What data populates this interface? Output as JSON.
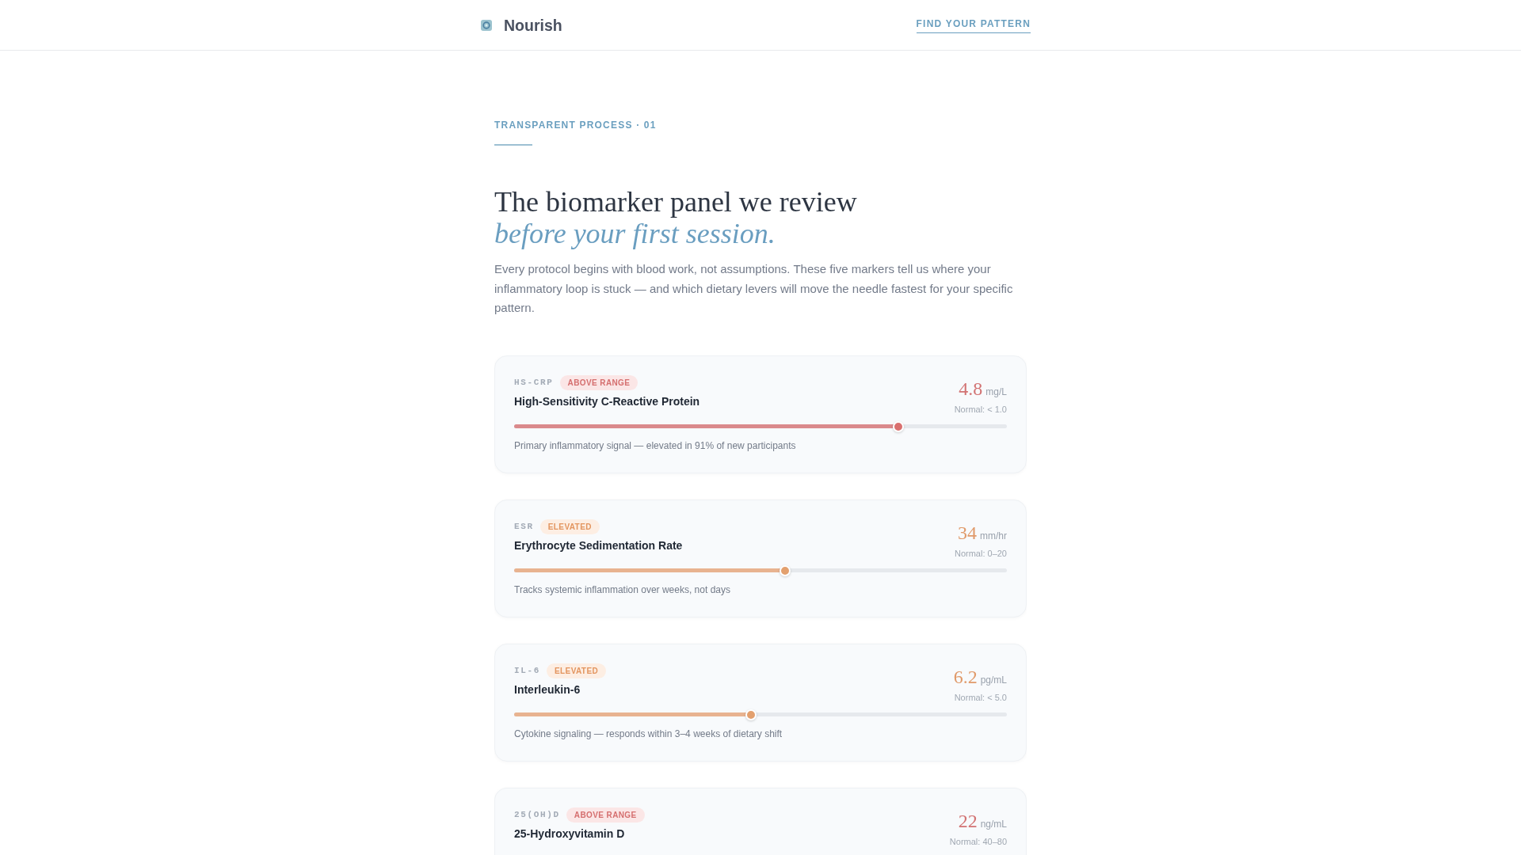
{
  "header": {
    "brand": "Nourish",
    "link": "FIND YOUR PATTERN"
  },
  "intro": {
    "eyebrow": "TRANSPARENT PROCESS · 01",
    "heading": "The biomarker panel we review",
    "heading_accent": "before your first session.",
    "body": "Every protocol begins with blood work, not assumptions. These five markers tell us where your inflammatory loop is stuck — and which dietary levers will move the needle fastest for your specific pattern."
  },
  "markers": [
    {
      "code": "HS-CRP",
      "kind": "above",
      "badge": "ABOVE RANGE",
      "name": "High-Sensitivity C-Reactive Protein",
      "value": "4.8",
      "unit": "mg/L",
      "normal": "Normal: < 1.0",
      "level": 0.78,
      "note": "Primary inflammatory signal — elevated in 91% of new participants"
    },
    {
      "code": "ESR",
      "kind": "elevated",
      "badge": "ELEVATED",
      "name": "Erythrocyte Sedimentation Rate",
      "value": "34",
      "unit": "mm/hr",
      "normal": "Normal: 0–20",
      "level": 0.55,
      "note": "Tracks systemic inflammation over weeks, not days"
    },
    {
      "code": "IL-6",
      "kind": "elevated",
      "badge": "ELEVATED",
      "name": "Interleukin-6",
      "value": "6.2",
      "unit": "pg/mL",
      "normal": "Normal: < 5.0",
      "level": 0.48,
      "note": "Cytokine signaling — responds within 3–4 weeks of dietary shift"
    },
    {
      "code": "25(OH)D",
      "kind": "above",
      "badge": "ABOVE RANGE",
      "name": "25-Hydroxyvitamin D",
      "value": "22",
      "unit": "ng/mL",
      "normal": "Normal: 40–80"
    }
  ]
}
